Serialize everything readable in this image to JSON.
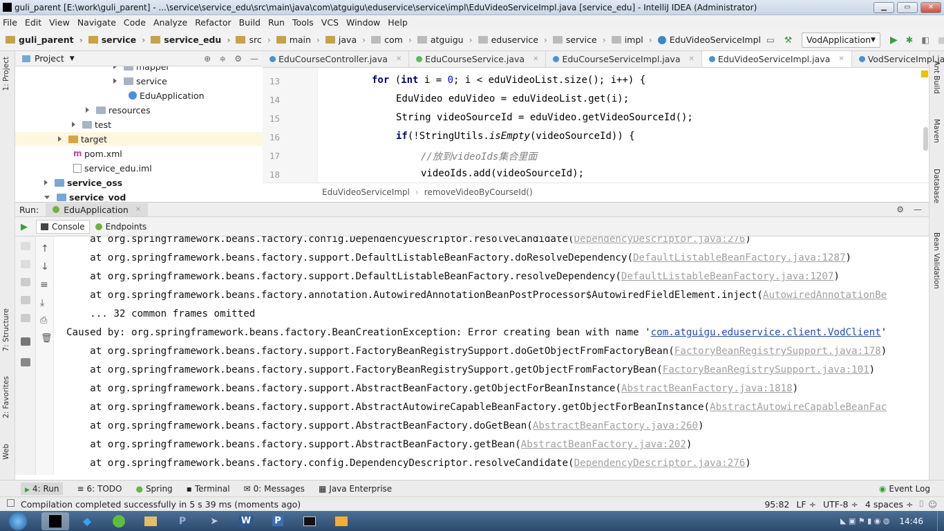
{
  "window": {
    "title": "guli_parent [E:\\work\\guli_parent] - ...\\service\\service_edu\\src\\main\\java\\com\\atguigu\\eduservice\\service\\impl\\EduVideoServiceImpl.java [service_edu] - IntelliJ IDEA (Administrator)"
  },
  "menu": [
    "File",
    "Edit",
    "View",
    "Navigate",
    "Code",
    "Analyze",
    "Refactor",
    "Build",
    "Run",
    "Tools",
    "VCS",
    "Window",
    "Help"
  ],
  "breadcrumb": [
    "guli_parent",
    "service",
    "service_edu",
    "src",
    "main",
    "java",
    "com",
    "atguigu",
    "eduservice",
    "service",
    "impl",
    "EduVideoServiceImpl"
  ],
  "run_config": "VodApplication",
  "project": {
    "label": "Project",
    "tree": [
      {
        "label": "mapper",
        "indent": 3,
        "expander": "right",
        "bold": false
      },
      {
        "label": "service",
        "indent": 3,
        "expander": "right",
        "bold": false
      },
      {
        "label": "EduApplication",
        "indent": 4,
        "expander": "none",
        "bold": false
      },
      {
        "label": "resources",
        "indent": 2,
        "expander": "right",
        "bold": false
      },
      {
        "label": "test",
        "indent": 1,
        "expander": "right",
        "bold": false
      },
      {
        "label": "target",
        "indent": 0,
        "expander": "right",
        "bold": false
      },
      {
        "label": "pom.xml",
        "indent": 1,
        "expander": "none",
        "bold": false
      },
      {
        "label": "service_edu.iml",
        "indent": 1,
        "expander": "none",
        "bold": false
      },
      {
        "label": "service_oss",
        "indent": -1,
        "expander": "right",
        "bold": true
      },
      {
        "label": "service_vod",
        "indent": -1,
        "expander": "down",
        "bold": true
      }
    ]
  },
  "tabs": [
    {
      "label": "EduCourseController.java",
      "color": "#4a90d9",
      "active": false
    },
    {
      "label": "EduCourseService.java",
      "color": "#5cb85c",
      "active": false
    },
    {
      "label": "EduCourseServiceImpl.java",
      "color": "#4a90d9",
      "active": false
    },
    {
      "label": "EduVideoServiceImpl.java",
      "color": "#4a90d9",
      "active": true
    },
    {
      "label": "VodServiceImpl.java",
      "color": "#4a90d9",
      "active": false
    }
  ],
  "editor": {
    "lines": [
      {
        "n": "13",
        "indent": 4
      },
      {
        "n": "14",
        "indent": 5
      },
      {
        "n": "15",
        "indent": 5
      },
      {
        "n": "16",
        "indent": 5
      },
      {
        "n": "17",
        "indent": 6
      },
      {
        "n": "18",
        "indent": 6
      }
    ],
    "code": {
      "l13_for": "for",
      "l13_a": " (",
      "l13_int": "int",
      "l13_b": " i = ",
      "l13_zero": "0",
      "l13_c": "; i < eduVideoList.size(); i++) {",
      "l14": "EduVideo eduVideo = eduVideoList.get(i);",
      "l15": "String videoSourceId = eduVideo.getVideoSourceId();",
      "l16_if": "if",
      "l16_a": "(!StringUtils.",
      "l16_empty": "isEmpty",
      "l16_b": "(videoSourceId)) {",
      "l17": "//放到videoIds集合里面",
      "l18": "videoIds.add(videoSourceId);"
    },
    "crumb_class": "EduVideoServiceImpl",
    "crumb_method": "removeVideoByCourseId()"
  },
  "run": {
    "label": "Run:",
    "config": "EduApplication",
    "console_tab": "Console",
    "endpoints_tab": "Endpoints"
  },
  "console": [
    {
      "text": "    at org.springframework.beans.factory.config.DependencyDescriptor.resolveCandidate(",
      "link": "DependencyDescriptor.java:276",
      "tail": ")"
    },
    {
      "text": "    at org.springframework.beans.factory.support.DefaultListableBeanFactory.doResolveDependency(",
      "link": "DefaultListableBeanFactory.java:1287",
      "tail": ")"
    },
    {
      "text": "    at org.springframework.beans.factory.support.DefaultListableBeanFactory.resolveDependency(",
      "link": "DefaultListableBeanFactory.java:1207",
      "tail": ")"
    },
    {
      "text": "    at org.springframework.beans.factory.annotation.AutowiredAnnotationBeanPostProcessor$AutowiredFieldElement.inject(",
      "link": "AutowiredAnnotationBe",
      "tail": ""
    },
    {
      "text": "    ... 32 common frames omitted",
      "link": "",
      "tail": ""
    },
    {
      "text": "Caused by: org.springframework.beans.factory.BeanCreationException: Error creating bean with name '",
      "link2": "com.atguigu.eduservice.client.VodClient",
      "tail": "'"
    },
    {
      "text": "    at org.springframework.beans.factory.support.FactoryBeanRegistrySupport.doGetObjectFromFactoryBean(",
      "link": "FactoryBeanRegistrySupport.java:178",
      "tail": ")"
    },
    {
      "text": "    at org.springframework.beans.factory.support.FactoryBeanRegistrySupport.getObjectFromFactoryBean(",
      "link": "FactoryBeanRegistrySupport.java:101",
      "tail": ")"
    },
    {
      "text": "    at org.springframework.beans.factory.support.AbstractBeanFactory.getObjectForBeanInstance(",
      "link": "AbstractBeanFactory.java:1818",
      "tail": ")"
    },
    {
      "text": "    at org.springframework.beans.factory.support.AbstractAutowireCapableBeanFactory.getObjectForBeanInstance(",
      "link": "AbstractAutowireCapableBeanFac",
      "tail": ""
    },
    {
      "text": "    at org.springframework.beans.factory.support.AbstractBeanFactory.doGetBean(",
      "link": "AbstractBeanFactory.java:260",
      "tail": ")"
    },
    {
      "text": "    at org.springframework.beans.factory.support.AbstractBeanFactory.getBean(",
      "link": "AbstractBeanFactory.java:202",
      "tail": ")"
    },
    {
      "text": "    at org.springframework.beans.factory.config.DependencyDescriptor.resolveCandidate(",
      "link": "DependencyDescriptor.java:276",
      "tail": ")"
    }
  ],
  "bottom_tabs": [
    "4: Run",
    "6: TODO",
    "Spring",
    "Terminal",
    "0: Messages",
    "Java Enterprise"
  ],
  "event_log": "Event Log",
  "status": {
    "message": "Compilation completed successfully in 5 s 39 ms (moments ago)",
    "position": "95:82",
    "line_sep": "LF ÷",
    "encoding": "UTF-8 ÷",
    "indent": "4 spaces ÷"
  },
  "left_strip": [
    "1: Project",
    "7: Structure",
    "2: Favorites",
    "Web"
  ],
  "right_strip": [
    "Ant Build",
    "Maven",
    "Database",
    "Bean Validation"
  ],
  "taskbar": {
    "clock": "14:46"
  }
}
